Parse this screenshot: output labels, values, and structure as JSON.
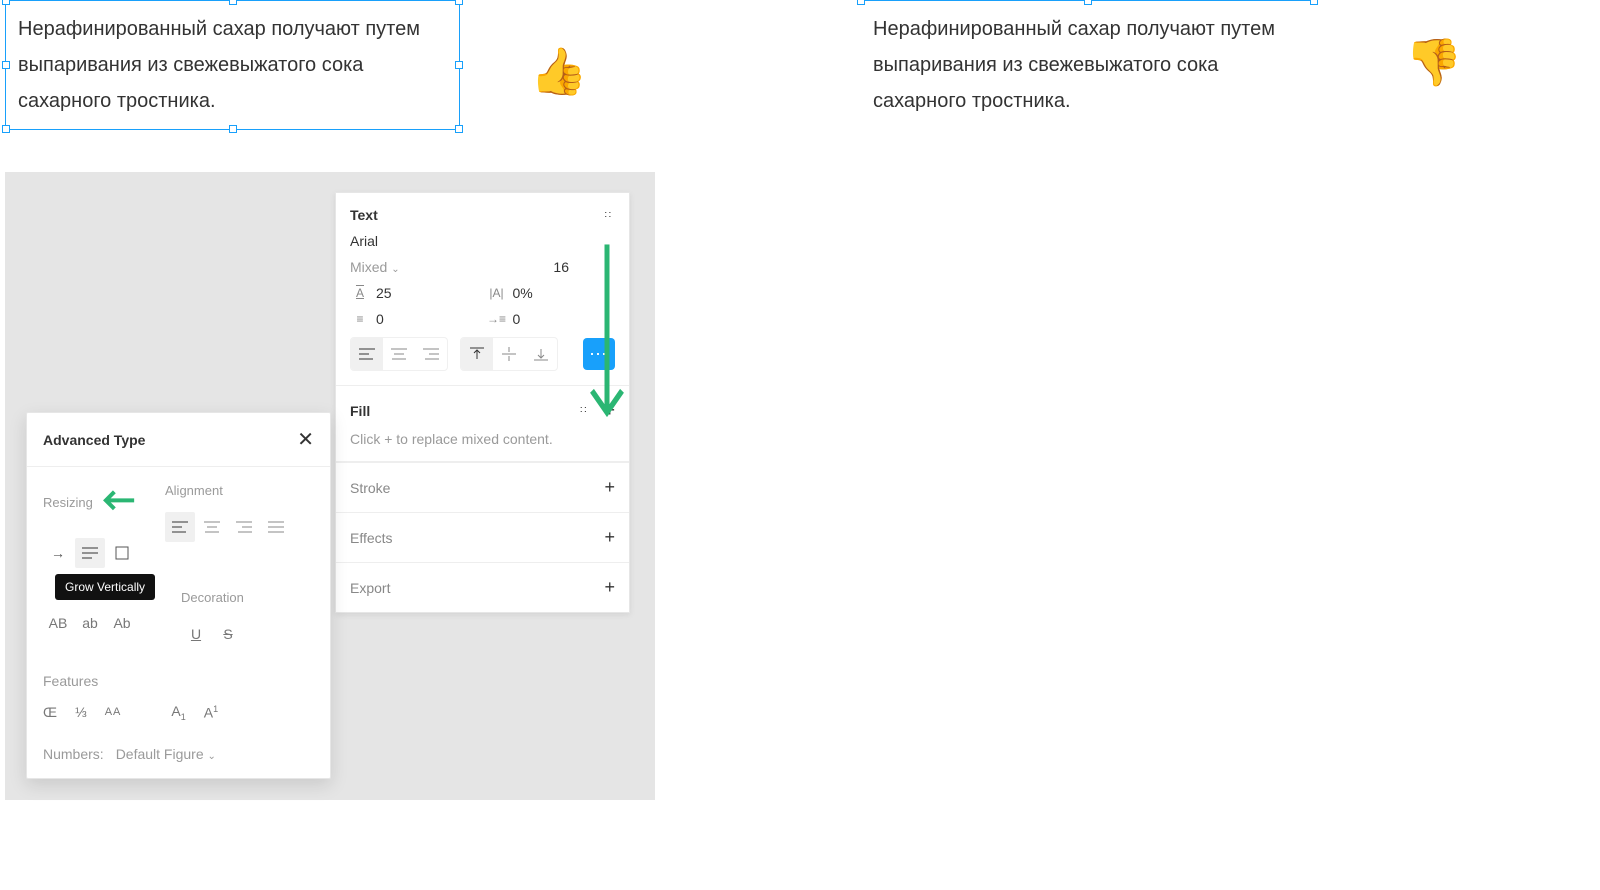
{
  "example_text": "Нерафинированный сахар получают путем выпаривания из свежевыжатого сока сахарного тростника.",
  "right_panel": {
    "title": "Text",
    "font_family": "Arial",
    "font_weight": "Mixed",
    "font_size": "16",
    "line_height": "25",
    "letter_spacing": "0%",
    "para_spacing": "0",
    "para_indent": "0",
    "more_label": "⋯",
    "fill": {
      "title": "Fill",
      "placeholder": "Click + to replace mixed content."
    },
    "stroke": "Stroke",
    "effects": "Effects",
    "export": "Export"
  },
  "advanced": {
    "title": "Advanced Type",
    "resizing_label": "Resizing",
    "alignment_label": "Alignment",
    "tooltip": "Grow Vertically",
    "decoration_label": "Decoration",
    "features_label": "Features",
    "numbers_label": "Numbers:",
    "numbers_value": "Default Figure",
    "case_AB": "AB",
    "case_ab": "ab",
    "case_Ab": "Ab",
    "deco_U": "U",
    "deco_S": "S"
  }
}
